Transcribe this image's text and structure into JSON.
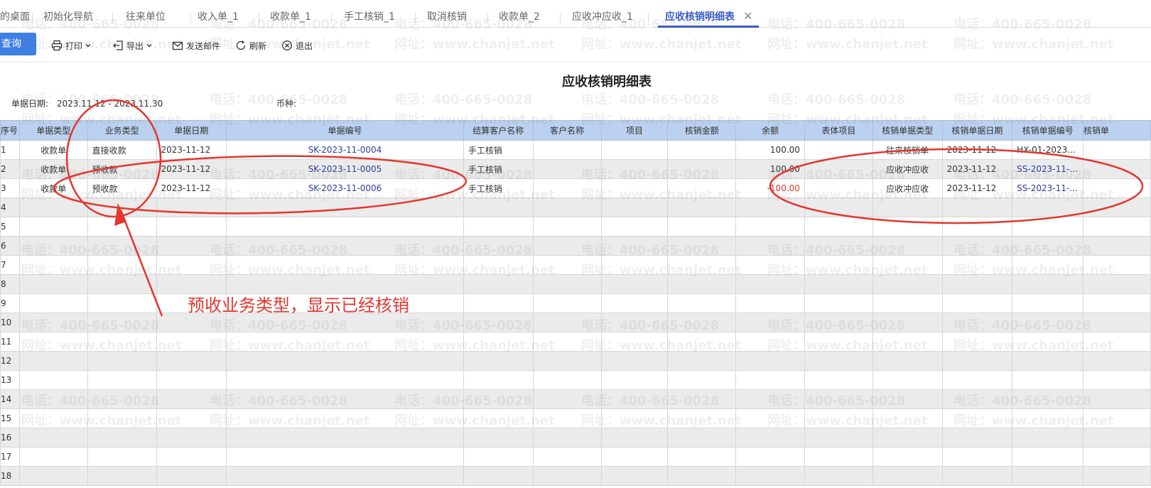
{
  "tabs": [
    {
      "label": "的桌面",
      "active": false
    },
    {
      "label": "初始化导航",
      "active": false
    },
    {
      "label": "往来单位",
      "active": false
    },
    {
      "label": "收入单_1",
      "active": false
    },
    {
      "label": "收款单_1",
      "active": false
    },
    {
      "label": "手工核销_1",
      "active": false
    },
    {
      "label": "取消核销",
      "active": false
    },
    {
      "label": "收款单_2",
      "active": false
    },
    {
      "label": "应收冲应收_1",
      "active": false
    },
    {
      "label": "应收核销明细表",
      "active": true
    }
  ],
  "toolbar": {
    "query": "查询",
    "print": "打印",
    "export": "导出",
    "send_mail": "发送邮件",
    "refresh": "刷新",
    "exit": "退出"
  },
  "report": {
    "title": "应收核销明细表",
    "date_label": "单据日期:",
    "date_value": "2023.11.12 - 2023.11.30",
    "currency_label": "币种:"
  },
  "columns": [
    "序号",
    "单据类型",
    "业务类型",
    "单据日期",
    "单据编号",
    "结算客户名称",
    "客户名称",
    "项目",
    "核销金额",
    "余额",
    "表体项目",
    "核销单据类型",
    "核销单据日期",
    "核销单据编号",
    "核销单"
  ],
  "rows": [
    {
      "no": "1",
      "doc_type": "收款单",
      "biz_type": "直接收款",
      "date": "2023-11-12",
      "code": "SK-2023-11-0004",
      "settle": "手工核销",
      "customer": "",
      "project": "",
      "amount": "",
      "balance": "100.00",
      "body_item": "",
      "wo_type": "往来核销单",
      "wo_date": "2023-11-12",
      "wo_code": "HX-01-2023..."
    },
    {
      "no": "2",
      "doc_type": "收款单",
      "biz_type": "预收款",
      "date": "2023-11-12",
      "code": "SK-2023-11-0005",
      "settle": "手工核销",
      "customer": "",
      "project": "",
      "amount": "",
      "balance": "100.00",
      "body_item": "",
      "wo_type": "应收冲应收",
      "wo_date": "2023-11-12",
      "wo_code": "SS-2023-11-..."
    },
    {
      "no": "3",
      "doc_type": "收款单",
      "biz_type": "预收款",
      "date": "2023-11-12",
      "code": "SK-2023-11-0006",
      "settle": "手工核销",
      "customer": "",
      "project": "",
      "amount": "",
      "balance": "-100.00",
      "body_item": "",
      "wo_type": "应收冲应收",
      "wo_date": "2023-11-12",
      "wo_code": "SS-2023-11-..."
    }
  ],
  "empty_row_numbers": [
    "4",
    "5",
    "6",
    "7",
    "8",
    "9",
    "10",
    "11",
    "12",
    "13",
    "14",
    "15",
    "16",
    "17",
    "18"
  ],
  "watermark": {
    "phone": "电话：400-665-0028",
    "site": "网址：www.chanjet.net"
  },
  "annotation": {
    "text": "预收业务类型，显示已经核销",
    "color": "#e5352c"
  },
  "colors": {
    "accent": "#3d7fe5",
    "header_bg": "#bad1ef",
    "link": "#2b3e9e",
    "negative": "#e5352c"
  }
}
